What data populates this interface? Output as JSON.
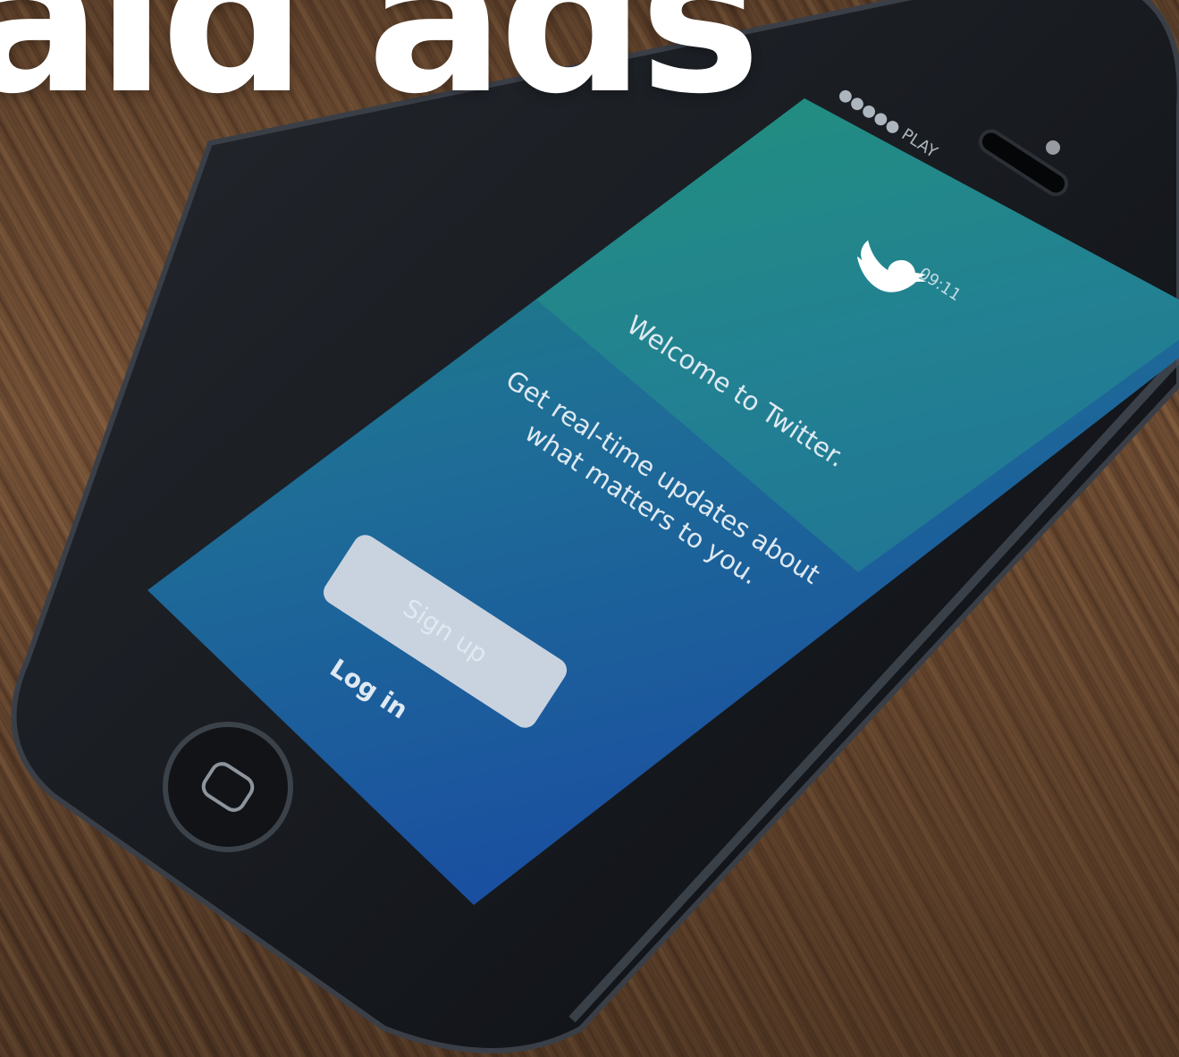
{
  "overlay": {
    "headline": "aid ads"
  },
  "phone": {
    "status_bar": {
      "carrier": "●●●●● PLAY",
      "time": "09:11"
    },
    "app": {
      "logo_icon": "twitter-bird-icon",
      "welcome": "Welcome to Twitter.",
      "tagline_line1": "Get real-time updates about",
      "tagline_line2": "what matters to you.",
      "signup_label": "Sign up",
      "login_label": "Log in"
    }
  },
  "colors": {
    "screen_top": "#1f8a6e",
    "screen_bottom": "#1a4fa0",
    "button_fill": "#c9d3df",
    "phone_body": "#15181d"
  }
}
